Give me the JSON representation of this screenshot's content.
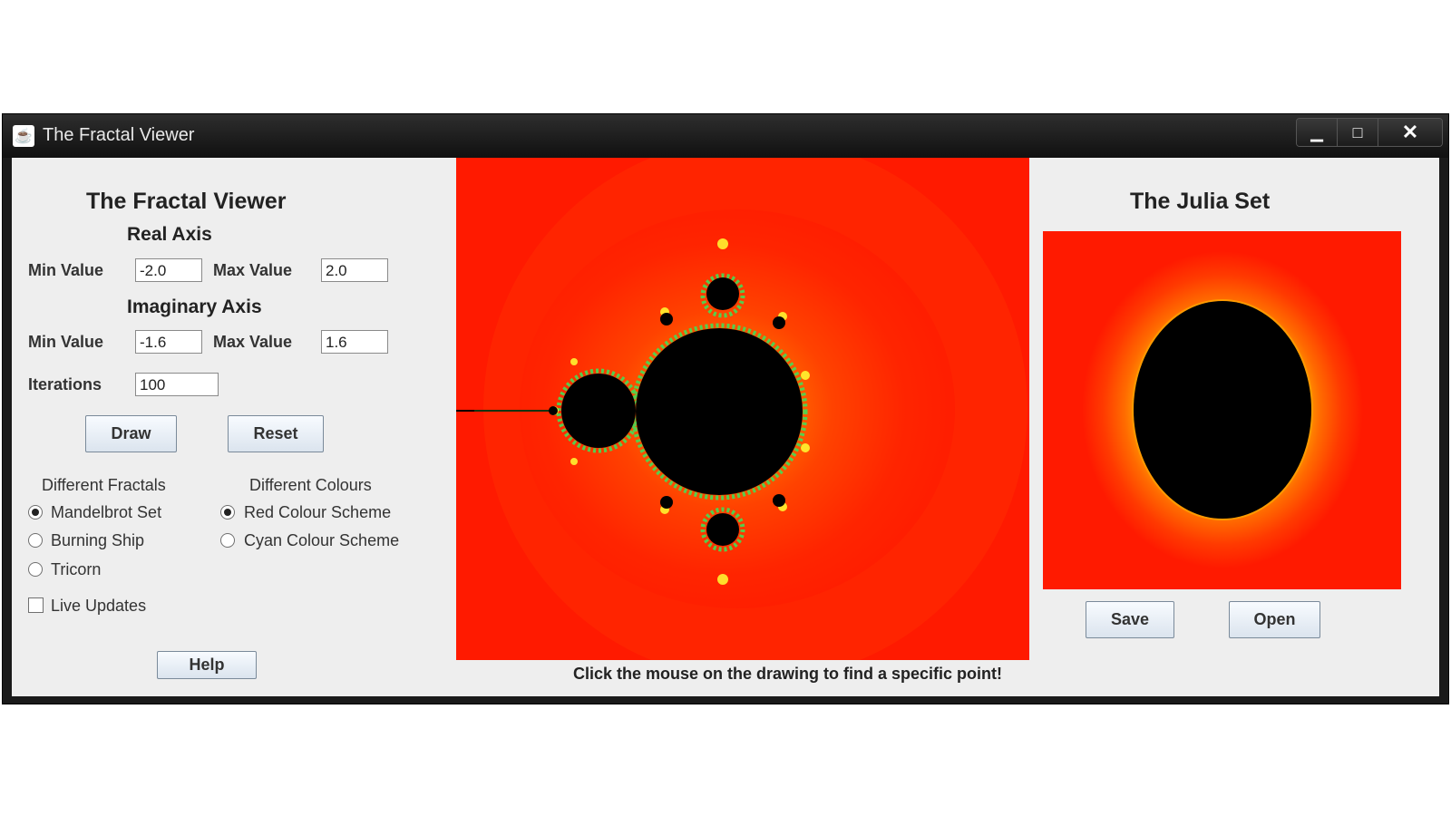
{
  "window": {
    "title": "The Fractal Viewer",
    "controls": {
      "minimize": "▁",
      "maximize": "□",
      "close": "✕"
    }
  },
  "left_panel": {
    "title": "The Fractal Viewer",
    "real_axis": {
      "heading": "Real Axis",
      "min_label": "Min Value",
      "min_value": "-2.0",
      "max_label": "Max Value",
      "max_value": "2.0"
    },
    "imaginary_axis": {
      "heading": "Imaginary Axis",
      "min_label": "Min Value",
      "min_value": "-1.6",
      "max_label": "Max Value",
      "max_value": "1.6"
    },
    "iterations": {
      "label": "Iterations",
      "value": "100"
    },
    "draw_button": "Draw",
    "reset_button": "Reset",
    "fractals": {
      "heading": "Different Fractals",
      "options": [
        {
          "label": "Mandelbrot Set",
          "selected": true
        },
        {
          "label": "Burning Ship",
          "selected": false
        },
        {
          "label": "Tricorn",
          "selected": false
        }
      ]
    },
    "colours": {
      "heading": "Different Colours",
      "options": [
        {
          "label": "Red Colour Scheme",
          "selected": true
        },
        {
          "label": "Cyan Colour Scheme",
          "selected": false
        }
      ]
    },
    "live_updates": {
      "label": "Live Updates",
      "checked": false
    },
    "help_button": "Help"
  },
  "center_panel": {
    "hint": "Click the mouse on the drawing to find a specific point!",
    "colors": {
      "background": "#ff1a00",
      "set": "#000000"
    }
  },
  "right_panel": {
    "title": "The Julia Set",
    "save_button": "Save",
    "open_button": "Open"
  }
}
